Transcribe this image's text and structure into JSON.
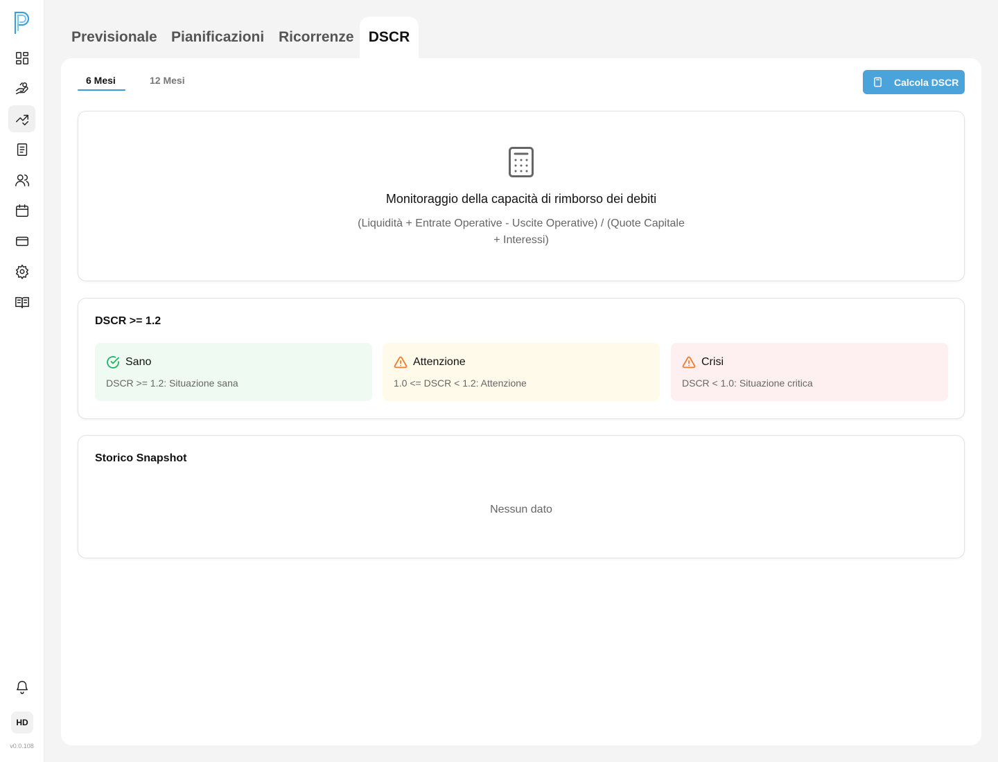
{
  "sidebar": {
    "items": [
      {
        "icon": "dashboard-icon"
      },
      {
        "icon": "hand-coins-icon"
      },
      {
        "icon": "trending-icon",
        "active": true
      },
      {
        "icon": "document-icon"
      },
      {
        "icon": "users-icon"
      },
      {
        "icon": "calendar-icon"
      },
      {
        "icon": "credit-card-icon"
      },
      {
        "icon": "settings-icon"
      },
      {
        "icon": "book-icon"
      }
    ],
    "bell_icon": "bell-icon",
    "avatar_initials": "HD",
    "version": "v0.0.108"
  },
  "tabs": {
    "previsionale": "Previsionale",
    "pianificazioni": "Pianificazioni",
    "ricorrenze": "Ricorrenze",
    "dscr": "DSCR",
    "active": "DSCR"
  },
  "subtabs": {
    "six_months": "6 Mesi",
    "twelve_months": "12 Mesi",
    "active": "6 Mesi"
  },
  "calc_button": {
    "label": "Calcola DSCR",
    "icon": "calculator-icon"
  },
  "hero": {
    "icon": "calculator-icon",
    "title": "Monitoraggio della capacità di rimborso dei debiti",
    "formula": "(Liquidità + Entrate Operative - Uscite Operative) / (Quote Capitale + Interessi)"
  },
  "threshold_card": {
    "title": "DSCR >= 1.2",
    "statuses": [
      {
        "title": "Sano",
        "desc": "DSCR >= 1.2: Situazione sana",
        "icon": "check-circle-icon",
        "bg": "#eefaf2",
        "color": "#22b35e"
      },
      {
        "title": "Attenzione",
        "desc": "1.0 <= DSCR < 1.2: Attenzione",
        "icon": "warning-icon",
        "bg": "#fffaea",
        "color": "#f07b2a"
      },
      {
        "title": "Crisi",
        "desc": "DSCR < 1.0: Situazione critica",
        "icon": "warning-icon",
        "bg": "#fef0f0",
        "color": "#f07b2a"
      }
    ]
  },
  "history_card": {
    "title": "Storico Snapshot",
    "empty": "Nessun dato"
  },
  "colors": {
    "accent": "#4aa3db",
    "background": "#f4f4f4"
  }
}
